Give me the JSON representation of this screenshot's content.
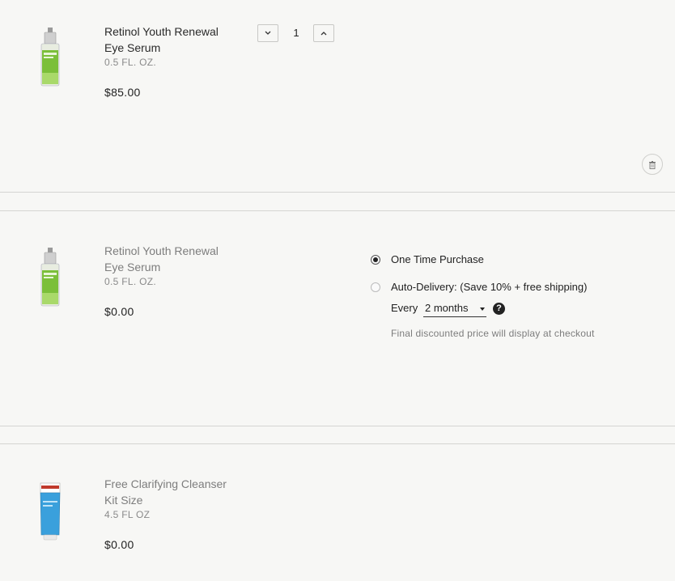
{
  "cart": {
    "items": [
      {
        "name": "Retinol Youth Renewal Eye Serum",
        "size": "0.5 FL. OZ.",
        "price": "$85.00",
        "quantity": "1",
        "image": "green-serum-bottle"
      },
      {
        "name": "Retinol Youth Renewal Eye Serum",
        "size": "0.5 FL. OZ.",
        "price": "$0.00",
        "image": "green-serum-bottle"
      },
      {
        "name": "Free Clarifying Cleanser Kit Size",
        "size": "4.5 FL OZ",
        "price": "$0.00",
        "image": "blue-cleanser-tube"
      }
    ],
    "purchase_options": {
      "one_time_label": "One Time Purchase",
      "auto_delivery_label": "Auto-Delivery: (Save 10% + free shipping)",
      "every_label": "Every",
      "frequency_selected": "2 months",
      "help_glyph": "?",
      "note": "Final discounted price will display at checkout",
      "selected": "one_time"
    },
    "icons": {
      "decrement": "chevron-down-icon",
      "increment": "chevron-up-icon",
      "remove": "trash-icon",
      "help": "question-circle-icon"
    }
  }
}
